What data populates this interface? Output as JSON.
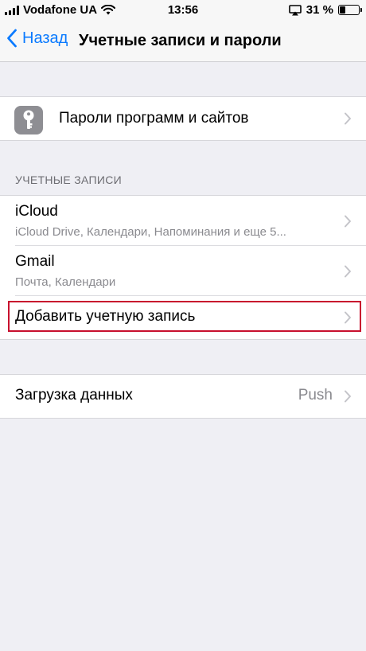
{
  "status_bar": {
    "carrier": "Vodafone UA",
    "time": "13:56",
    "battery": "31 %",
    "battery_level": 0.31,
    "icons": [
      "signal-bars-icon",
      "wifi-icon",
      "airplay-icon",
      "battery-icon"
    ]
  },
  "nav": {
    "back_label": "Назад",
    "title": "Учетные записи и пароли"
  },
  "passwords": {
    "label": "Пароли программ и сайтов",
    "icon": "key-icon"
  },
  "accounts": {
    "header": "УЧЕТНЫЕ ЗАПИСИ",
    "items": [
      {
        "title": "iCloud",
        "subtitle": "iCloud Drive, Календари, Напоминания и еще 5..."
      },
      {
        "title": "Gmail",
        "subtitle": "Почта, Календари"
      }
    ],
    "add_label": "Добавить учетную запись"
  },
  "fetch": {
    "label": "Загрузка данных",
    "value": "Push"
  },
  "colors": {
    "accent": "#0a7aff",
    "highlight": "#c8102e",
    "background": "#efeff4"
  }
}
